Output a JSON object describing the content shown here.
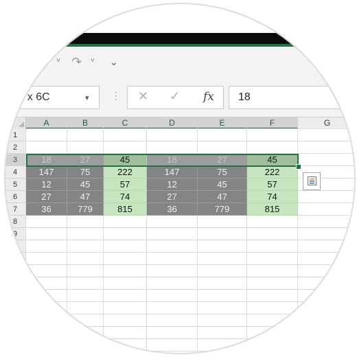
{
  "quick_access": {
    "icons": [
      "undo-icon",
      "redo-icon",
      "customize-qat-icon"
    ],
    "undo_glyph": "↶",
    "redo_glyph": "↷",
    "more_glyph": "⌄",
    "caret_glyph": "˅"
  },
  "formula_bar": {
    "name_box": "x 6C",
    "name_box_partial_prefix": "-",
    "dropdown_glyph": "▾",
    "divider_glyph": "⋮",
    "cancel_glyph": "✕",
    "enter_glyph": "✓",
    "fx_label": "fx",
    "value": "18"
  },
  "grid": {
    "columns": [
      "A",
      "B",
      "C",
      "D",
      "E",
      "F",
      "G"
    ],
    "selected_columns": [
      "A",
      "B",
      "C",
      "D",
      "E",
      "F"
    ],
    "rows": [
      "1",
      "2",
      "3",
      "4",
      "5",
      "6",
      "7",
      "8",
      "9"
    ],
    "selected_row": "3",
    "cells": [
      {
        "row": 3,
        "values": [
          "18",
          "27",
          "45",
          "18",
          "27",
          "45"
        ]
      },
      {
        "row": 4,
        "values": [
          "147",
          "75",
          "222",
          "147",
          "75",
          "222"
        ]
      },
      {
        "row": 5,
        "values": [
          "12",
          "45",
          "57",
          "12",
          "45",
          "57"
        ]
      },
      {
        "row": 6,
        "values": [
          "27",
          "47",
          "74",
          "27",
          "47",
          "74"
        ]
      },
      {
        "row": 7,
        "values": [
          "36",
          "779",
          "815",
          "36",
          "779",
          "815"
        ]
      }
    ],
    "fill_colors": {
      "gray": "#848484",
      "green": "#c6e6bf",
      "accent": "#217346"
    }
  },
  "quick_analysis": {
    "icon": "quick-analysis-icon"
  }
}
